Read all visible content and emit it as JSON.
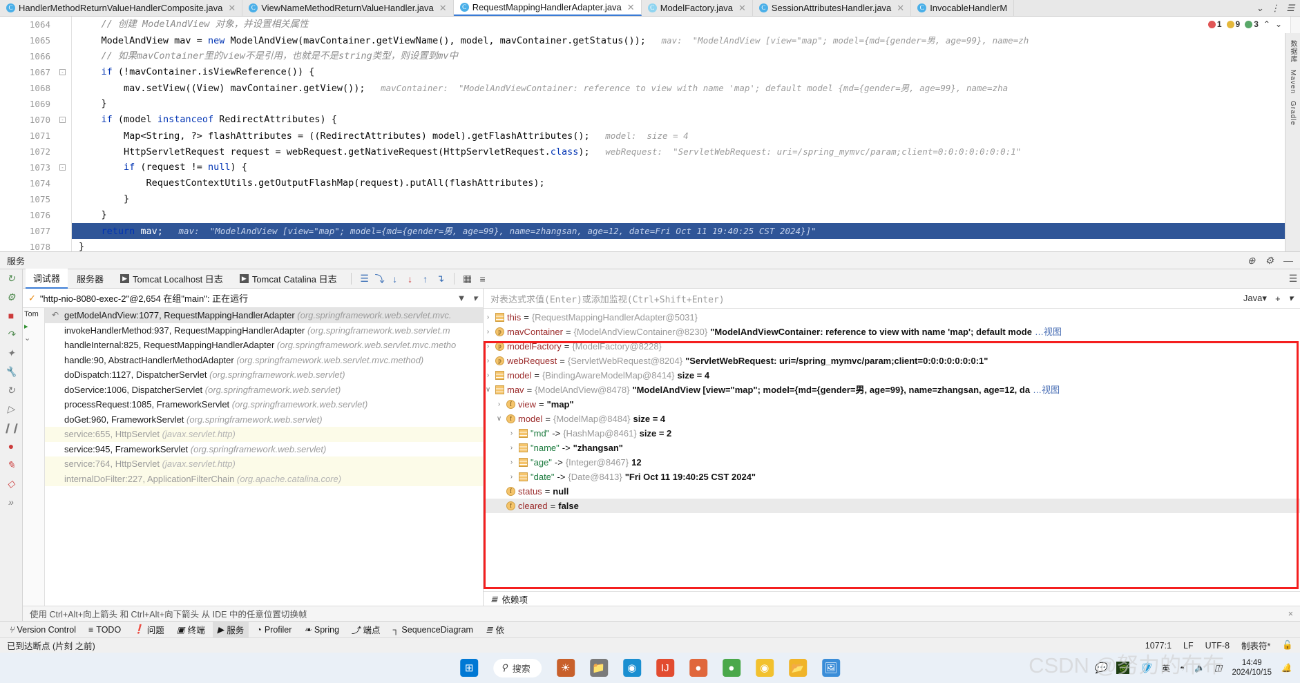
{
  "tabs": [
    {
      "label": "HandlerMethodReturnValueHandlerComposite.java",
      "icon": "java-class-icon",
      "active": false,
      "pale": false,
      "closable": true
    },
    {
      "label": "ViewNameMethodReturnValueHandler.java",
      "icon": "java-class-icon",
      "active": false,
      "pale": false,
      "closable": true
    },
    {
      "label": "RequestMappingHandlerAdapter.java",
      "icon": "java-class-icon",
      "active": true,
      "pale": false,
      "closable": true
    },
    {
      "label": "ModelFactory.java",
      "icon": "java-class-icon",
      "active": false,
      "pale": true,
      "closable": true
    },
    {
      "label": "SessionAttributesHandler.java",
      "icon": "java-class-icon",
      "active": false,
      "pale": false,
      "closable": true
    },
    {
      "label": "InvocableHandlerM",
      "icon": "java-class-icon",
      "active": false,
      "pale": false,
      "closable": false
    }
  ],
  "tabbar_right": {
    "chevron": "⌄",
    "more": "⋮",
    "menu": "☰"
  },
  "inspections": {
    "error_count": "1",
    "warning_count": "9",
    "ok_count": "3",
    "error_glyph": "❗",
    "warning_glyph": "⚠",
    "ok_glyph": "✔",
    "collapse": "⌃",
    "expand": "⌄"
  },
  "editor": {
    "lines": [
      {
        "num": "1064",
        "indent": 4,
        "segments": [
          {
            "t": "// 创建 ModelAndView 对象，并设置相关属性",
            "c": "cmt"
          }
        ],
        "hint": "",
        "fold": false
      },
      {
        "num": "1065",
        "indent": 4,
        "segments": [
          {
            "t": "ModelAndView mav = ",
            "c": ""
          },
          {
            "t": "new",
            "c": "kw"
          },
          {
            "t": " ModelAndView(mavContainer.getViewName(), model, mavContainer.getStatus());",
            "c": ""
          }
        ],
        "hint": "mav:  \"ModelAndView [view=\"map\"; model={md={gender=男, age=99}, name=zh",
        "fold": false
      },
      {
        "num": "1066",
        "indent": 4,
        "segments": [
          {
            "t": "// 如果mavContainer里的view不是引用，也就是不是string类型，则设置到mv中",
            "c": "cmt"
          }
        ],
        "hint": "",
        "fold": false
      },
      {
        "num": "1067",
        "indent": 4,
        "segments": [
          {
            "t": "if",
            "c": "kw"
          },
          {
            "t": " (!mavContainer.isViewReference()) {",
            "c": ""
          }
        ],
        "hint": "",
        "fold": true
      },
      {
        "num": "1068",
        "indent": 8,
        "segments": [
          {
            "t": "mav.setView((View) mavContainer.getView());",
            "c": ""
          }
        ],
        "hint": "mavContainer:  \"ModelAndViewContainer: reference to view with name 'map'; default model {md={gender=男, age=99}, name=zha",
        "fold": false
      },
      {
        "num": "1069",
        "indent": 4,
        "segments": [
          {
            "t": "}",
            "c": ""
          }
        ],
        "hint": "",
        "fold": false
      },
      {
        "num": "1070",
        "indent": 4,
        "segments": [
          {
            "t": "if",
            "c": "kw"
          },
          {
            "t": " (model ",
            "c": ""
          },
          {
            "t": "instanceof",
            "c": "kw"
          },
          {
            "t": " RedirectAttributes) {",
            "c": ""
          }
        ],
        "hint": "",
        "fold": true
      },
      {
        "num": "1071",
        "indent": 8,
        "segments": [
          {
            "t": "Map<String, ?> flashAttributes = ((RedirectAttributes) model).getFlashAttributes();",
            "c": ""
          }
        ],
        "hint": "model:  size = 4",
        "fold": false
      },
      {
        "num": "1072",
        "indent": 8,
        "segments": [
          {
            "t": "HttpServletRequest request = webRequest.getNativeRequest(HttpServletRequest.",
            "c": ""
          },
          {
            "t": "class",
            "c": "kw"
          },
          {
            "t": ");",
            "c": ""
          }
        ],
        "hint": "webRequest:  \"ServletWebRequest: uri=/spring_mymvc/param;client=0:0:0:0:0:0:0:1\"",
        "fold": false
      },
      {
        "num": "1073",
        "indent": 8,
        "segments": [
          {
            "t": "if",
            "c": "kw"
          },
          {
            "t": " (request != ",
            "c": ""
          },
          {
            "t": "null",
            "c": "kw"
          },
          {
            "t": ") {",
            "c": ""
          }
        ],
        "hint": "",
        "fold": true
      },
      {
        "num": "1074",
        "indent": 12,
        "segments": [
          {
            "t": "RequestContextUtils.getOutputFlashMap(request).putAll(flashAttributes);",
            "c": ""
          }
        ],
        "hint": "",
        "fold": false
      },
      {
        "num": "1075",
        "indent": 8,
        "segments": [
          {
            "t": "}",
            "c": ""
          }
        ],
        "hint": "",
        "fold": false
      },
      {
        "num": "1076",
        "indent": 4,
        "segments": [
          {
            "t": "}",
            "c": ""
          }
        ],
        "hint": "",
        "fold": false
      },
      {
        "num": "1077",
        "indent": 4,
        "segments": [
          {
            "t": "return",
            "c": "kw"
          },
          {
            "t": " mav;",
            "c": ""
          }
        ],
        "hint": "mav:  \"ModelAndView [view=\"map\"; model={md={gender=男, age=99}, name=zhangsan, age=12, date=Fri Oct 11 19:40:25 CST 2024}]\"",
        "fold": false,
        "highlight": true
      },
      {
        "num": "1078",
        "indent": 0,
        "segments": [
          {
            "t": "}",
            "c": ""
          }
        ],
        "hint": "",
        "fold": false
      }
    ]
  },
  "right_vstrip": [
    "数据库",
    "Maven",
    "Gradle"
  ],
  "services_header": {
    "title": "服务",
    "icons": [
      "globe-icon",
      "gear-icon",
      "minimize-icon"
    ],
    "globe": "⊕",
    "gear": "⚙",
    "minimize": "—"
  },
  "left_rail_icons": [
    "rerun-icon",
    "rerun-failed-icon",
    "stop-icon",
    "step-over-icon",
    "step-into-icon",
    "wrench-icon",
    "restart-icon",
    "resume-icon",
    "pause-icon",
    "record-icon",
    "camera-icon",
    "mute-breakpoints-icon",
    "more-icon"
  ],
  "debug_toolbar": {
    "tabs": [
      {
        "label": "调试器",
        "active": true,
        "icon": ""
      },
      {
        "label": "服务器",
        "active": false,
        "icon": ""
      },
      {
        "label": "Tomcat Localhost 日志",
        "active": false,
        "icon": "play-icon"
      },
      {
        "label": "Tomcat Catalina 日志",
        "active": false,
        "icon": "play-icon"
      }
    ],
    "buttons": [
      {
        "name": "layout-icon",
        "glyph": "☰",
        "color": "blue"
      },
      {
        "name": "step-over-icon",
        "glyph": "⤵",
        "color": "blue"
      },
      {
        "name": "step-into-icon",
        "glyph": "↓",
        "color": "blue"
      },
      {
        "name": "force-step-into-icon",
        "glyph": "↓",
        "color": "red"
      },
      {
        "name": "step-out-icon",
        "glyph": "↑",
        "color": "blue"
      },
      {
        "name": "run-to-cursor-icon",
        "glyph": "↴",
        "color": "blue"
      },
      {
        "name": "evaluate-icon",
        "glyph": "▦",
        "color": "grey"
      },
      {
        "name": "settings-icon",
        "glyph": "≡",
        "color": "grey"
      }
    ],
    "collapse_glyph": "☰"
  },
  "thread_selector": {
    "label": "\"http-nio-8080-exec-2\"@2,654 在组\"main\": 正在运行",
    "check": "✓",
    "filter_icon": "filter-icon",
    "filter_glyph": "▼",
    "dropdown_glyph": "▾"
  },
  "thread_node": {
    "label": "Tom"
  },
  "frames": [
    {
      "text": "getModelAndView:1077, RequestMappingHandlerAdapter",
      "pkg": "(org.springframework.web.servlet.mvc.",
      "selected": true,
      "library": false
    },
    {
      "text": "invokeHandlerMethod:937, RequestMappingHandlerAdapter",
      "pkg": "(org.springframework.web.servlet.m",
      "selected": false,
      "library": false
    },
    {
      "text": "handleInternal:825, RequestMappingHandlerAdapter",
      "pkg": "(org.springframework.web.servlet.mvc.metho",
      "selected": false,
      "library": false
    },
    {
      "text": "handle:90, AbstractHandlerMethodAdapter",
      "pkg": "(org.springframework.web.servlet.mvc.method)",
      "selected": false,
      "library": false
    },
    {
      "text": "doDispatch:1127, DispatcherServlet",
      "pkg": "(org.springframework.web.servlet)",
      "selected": false,
      "library": false
    },
    {
      "text": "doService:1006, DispatcherServlet",
      "pkg": "(org.springframework.web.servlet)",
      "selected": false,
      "library": false
    },
    {
      "text": "processRequest:1085, FrameworkServlet",
      "pkg": "(org.springframework.web.servlet)",
      "selected": false,
      "library": false
    },
    {
      "text": "doGet:960, FrameworkServlet",
      "pkg": "(org.springframework.web.servlet)",
      "selected": false,
      "library": false
    },
    {
      "text": "service:655, HttpServlet",
      "pkg": "(javax.servlet.http)",
      "selected": false,
      "library": true
    },
    {
      "text": "service:945, FrameworkServlet",
      "pkg": "(org.springframework.web.servlet)",
      "selected": false,
      "library": false
    },
    {
      "text": "service:764, HttpServlet",
      "pkg": "(javax.servlet.http)",
      "selected": false,
      "library": true
    },
    {
      "text": "internalDoFilter:227, ApplicationFilterChain",
      "pkg": "(org.apache.catalina.core)",
      "selected": false,
      "library": true
    }
  ],
  "watch": {
    "placeholder": "对表达式求值(Enter)或添加监视(Ctrl+Shift+Enter)",
    "lang": "Java",
    "lang_caret": "▾",
    "add_glyph": "+",
    "settings_glyph": "▾"
  },
  "variables": [
    {
      "indent": 0,
      "arrow": "›",
      "icon": "list",
      "name": "this",
      "op": " = ",
      "ref": "{RequestMappingHandlerAdapter@5031}",
      "value": "",
      "clip": "",
      "selected": false
    },
    {
      "indent": 0,
      "arrow": "›",
      "icon": "p",
      "name": "mavContainer",
      "op": " = ",
      "ref": "{ModelAndViewContainer@8230}",
      "value": "\"ModelAndViewContainer: reference to view with name 'map'; default mode",
      "clip": "…视图",
      "selected": false
    },
    {
      "indent": 0,
      "arrow": "›",
      "icon": "p",
      "name": "modelFactory",
      "op": " = ",
      "ref": "{ModelFactory@8228}",
      "value": "",
      "clip": "",
      "selected": false
    },
    {
      "indent": 0,
      "arrow": "›",
      "icon": "p",
      "name": "webRequest",
      "op": " = ",
      "ref": "{ServletWebRequest@8204}",
      "value": "\"ServletWebRequest: uri=/spring_mymvc/param;client=0:0:0:0:0:0:0:1\"",
      "clip": "",
      "selected": false
    },
    {
      "indent": 0,
      "arrow": "›",
      "icon": "list",
      "name": "model",
      "op": " = ",
      "ref": "{BindingAwareModelMap@8414}",
      "value": "size = 4",
      "clip": "",
      "selected": false,
      "bold_value": false
    },
    {
      "indent": 0,
      "arrow": "∨",
      "icon": "list",
      "name": "mav",
      "op": " = ",
      "ref": "{ModelAndView@8478}",
      "value": "\"ModelAndView [view=\"map\"; model={md={gender=男, age=99}, name=zhangsan, age=12, da",
      "clip": "…视图",
      "selected": false
    },
    {
      "indent": 1,
      "arrow": "›",
      "icon": "f",
      "name": "view",
      "op": " = ",
      "ref": "",
      "value": "\"map\"",
      "clip": "",
      "selected": false
    },
    {
      "indent": 1,
      "arrow": "∨",
      "icon": "f",
      "name": "model",
      "op": " = ",
      "ref": "{ModelMap@8484}",
      "value": "size = 4",
      "clip": "",
      "selected": false
    },
    {
      "indent": 2,
      "arrow": "›",
      "icon": "list",
      "name": "\"md\"",
      "op": " -> ",
      "ref": "{HashMap@8461}",
      "value": "size = 2",
      "clip": "",
      "selected": false,
      "key": true
    },
    {
      "indent": 2,
      "arrow": "›",
      "icon": "list",
      "name": "\"name\"",
      "op": " -> ",
      "ref": "",
      "value": "\"zhangsan\"",
      "clip": "",
      "selected": false,
      "key": true
    },
    {
      "indent": 2,
      "arrow": "›",
      "icon": "list",
      "name": "\"age\"",
      "op": " -> ",
      "ref": "{Integer@8467}",
      "value": "12",
      "clip": "",
      "selected": false,
      "key": true
    },
    {
      "indent": 2,
      "arrow": "›",
      "icon": "list",
      "name": "\"date\"",
      "op": " -> ",
      "ref": "{Date@8413}",
      "value": "\"Fri Oct 11 19:40:25 CST 2024\"",
      "clip": "",
      "selected": false,
      "key": true
    },
    {
      "indent": 1,
      "arrow": "",
      "icon": "f",
      "name": "status",
      "op": " = ",
      "ref": "",
      "value": "null",
      "clip": "",
      "selected": false
    },
    {
      "indent": 1,
      "arrow": "",
      "icon": "f",
      "name": "cleared",
      "op": " = ",
      "ref": "",
      "value": "false",
      "clip": "",
      "selected": true
    }
  ],
  "dependencies_bar": {
    "label": "依赖项",
    "icon": "layers-icon",
    "glyph": "≣"
  },
  "editor_hint_bar": {
    "text": "使用 Ctrl+Alt+向上箭头 和 Ctrl+Alt+向下箭头 从 IDE 中的任意位置切换帧",
    "close": "×"
  },
  "tool_windows": [
    {
      "label": "Version Control",
      "glyph": "⑂",
      "active": false
    },
    {
      "label": "TODO",
      "glyph": "≡",
      "active": false
    },
    {
      "label": "问题",
      "glyph": "❗",
      "active": false
    },
    {
      "label": "终端",
      "glyph": "▣",
      "active": false
    },
    {
      "label": "服务",
      "glyph": "▶",
      "active": true
    },
    {
      "label": "Profiler",
      "glyph": "◔",
      "active": false
    },
    {
      "label": "Spring",
      "glyph": "❧",
      "active": false
    },
    {
      "label": "端点",
      "glyph": "⤴",
      "active": false
    },
    {
      "label": "SequenceDiagram",
      "glyph": "┐",
      "active": false
    },
    {
      "label": "依",
      "glyph": "≣",
      "active": false
    }
  ],
  "statusbar": {
    "message": "已到达断点 (片刻 之前)",
    "position": "1077:1",
    "line_ending": "LF",
    "encoding": "UTF-8",
    "indent": "制表符*",
    "lock": "🔓"
  },
  "taskbar": {
    "start_glyph": "⊞",
    "search_placeholder": "搜索",
    "search_glyph": "⚲",
    "apps": [
      "task-view-icon",
      "widgets-icon",
      "folder-icon",
      "edge-icon",
      "idea-icon",
      "browser-icon",
      "chat-icon",
      "chrome-icon",
      "files-icon",
      "photos-icon"
    ],
    "tray": [
      "wechat-icon",
      "nvidia-icon",
      "security-icon"
    ],
    "ime": "英",
    "wifi_glyph": "",
    "volume_glyph": "🔊",
    "battery_glyph": "▭",
    "time": "14:49",
    "date": "2024/10/15",
    "notify_glyph": "🔔",
    "watermark": "CSDN @努力的布布"
  }
}
